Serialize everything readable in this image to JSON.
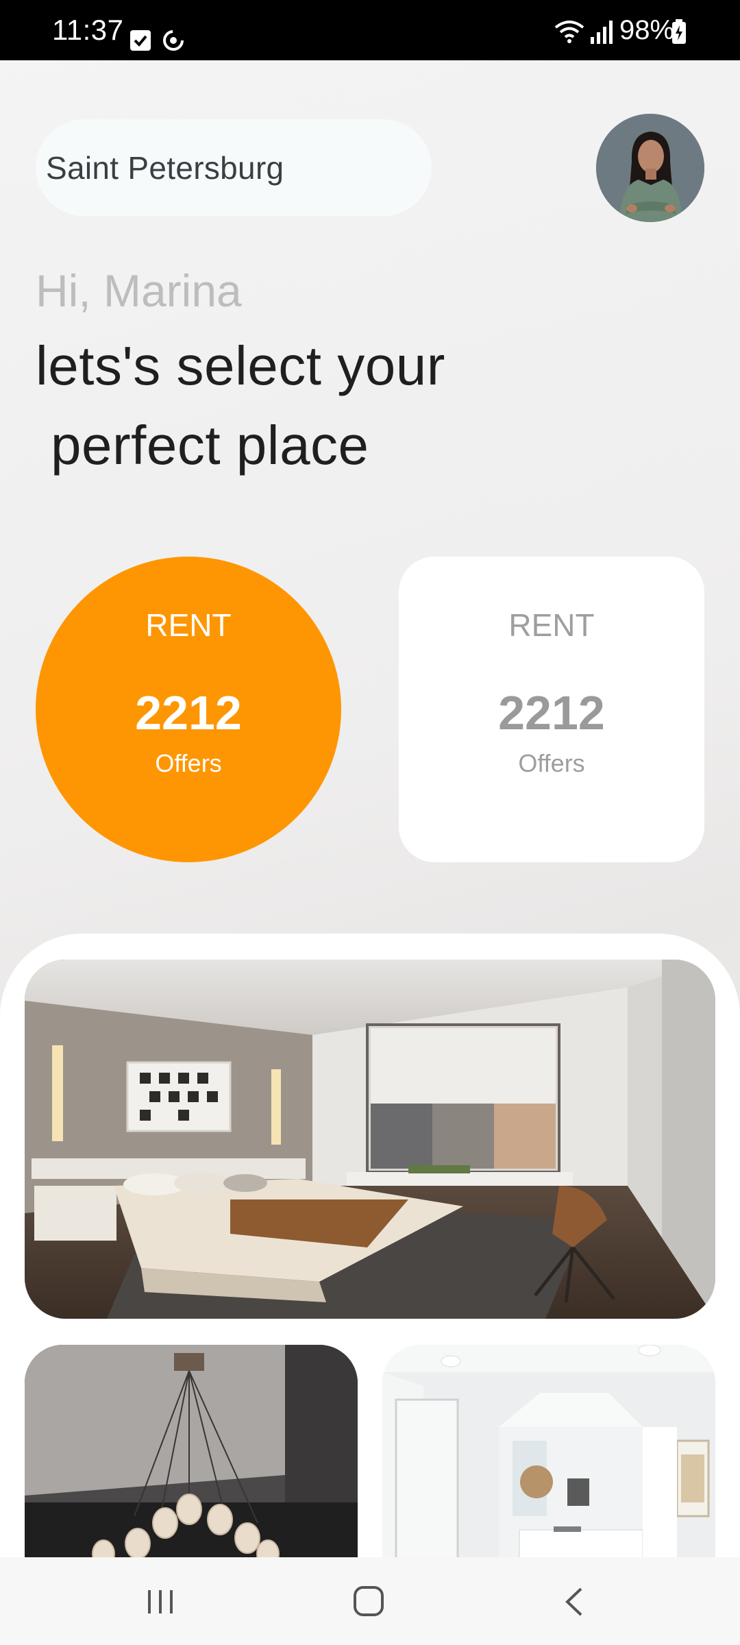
{
  "status_bar": {
    "time": "11:37",
    "battery": "98%",
    "icons": [
      "checkbox-notification-icon",
      "sync-icon",
      "wifi-icon",
      "signal-icon",
      "battery-charging-icon"
    ]
  },
  "header": {
    "location": "Saint Petersburg",
    "avatar_icon": "user-avatar"
  },
  "greeting": {
    "hello": "Hi, Marina",
    "line1": "lets's select your",
    "line2": "perfect place"
  },
  "offers": [
    {
      "label": "RENT",
      "count": "2212",
      "unit": "Offers",
      "style": "active",
      "color": "#fd9602"
    },
    {
      "label": "RENT",
      "count": "2212",
      "unit": "Offers",
      "style": "inactive",
      "color": "#ffffff"
    }
  ],
  "photos": [
    {
      "name": "bedroom-photo"
    },
    {
      "name": "chandelier-room-photo"
    },
    {
      "name": "kitchen-living-photo"
    }
  ],
  "nav_bar": {
    "icons": [
      "recent-apps-icon",
      "home-icon",
      "back-icon"
    ]
  },
  "colors": {
    "accent": "#fd9602",
    "text_dark": "#1f1f1f",
    "text_muted": "#bdbdbd"
  }
}
